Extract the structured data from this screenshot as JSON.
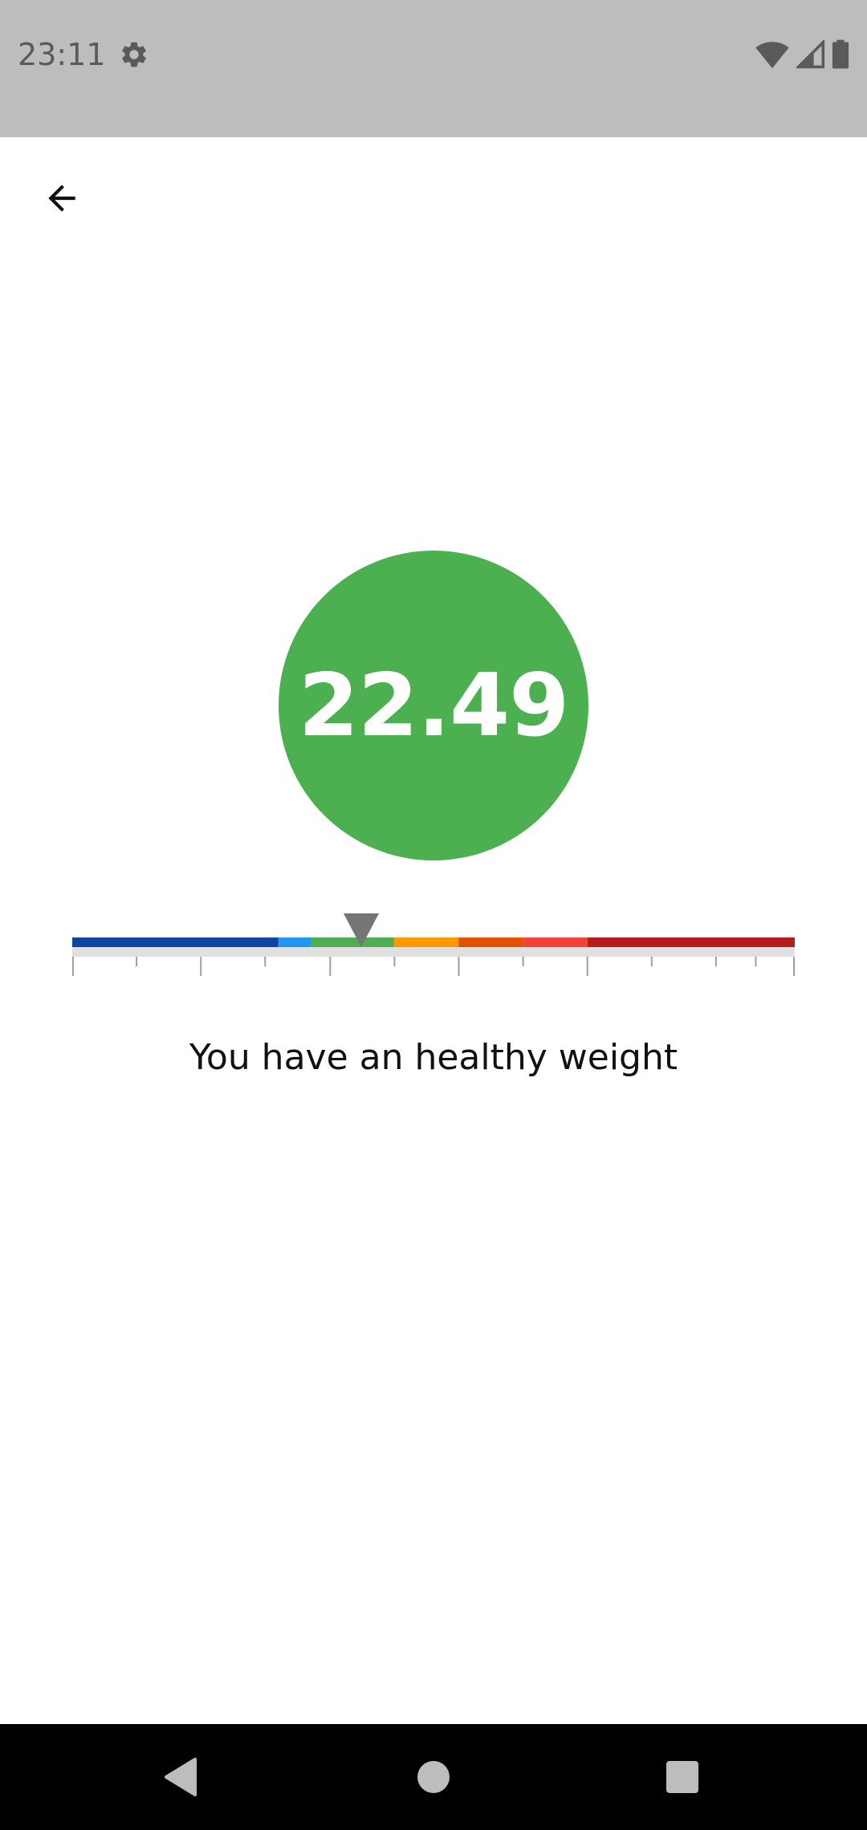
{
  "status_bar": {
    "time": "23:11",
    "icons": [
      "gear-icon",
      "wifi-icon",
      "cellular-signal-icon",
      "battery-icon"
    ]
  },
  "toolbar": {
    "back_icon": "arrow-left-icon"
  },
  "result": {
    "bmi_value": "22.49",
    "circle_color": "#4caf50",
    "message": "You have an healthy weight"
  },
  "scale": {
    "marker_color": "#757575",
    "marker_value_fraction": 0.4,
    "segments": [
      {
        "color": "#0d47a1",
        "from": 0.0,
        "to": 0.285
      },
      {
        "color": "#2196f3",
        "from": 0.285,
        "to": 0.33
      },
      {
        "color": "#4caf50",
        "from": 0.33,
        "to": 0.445
      },
      {
        "color": "#ff9800",
        "from": 0.445,
        "to": 0.535
      },
      {
        "color": "#e65100",
        "from": 0.535,
        "to": 0.624
      },
      {
        "color": "#f44336",
        "from": 0.624,
        "to": 0.713
      },
      {
        "color": "#b71c1c",
        "from": 0.713,
        "to": 1.0
      }
    ],
    "ticks_major": [
      0.0,
      0.178,
      0.357,
      0.535,
      0.713,
      1.0
    ],
    "ticks_minor": [
      0.089,
      0.267,
      0.446,
      0.624,
      0.802,
      0.891,
      0.946
    ]
  },
  "nav_bar": {
    "buttons": [
      "back-triangle-icon",
      "home-circle-icon",
      "recents-square-icon"
    ]
  }
}
